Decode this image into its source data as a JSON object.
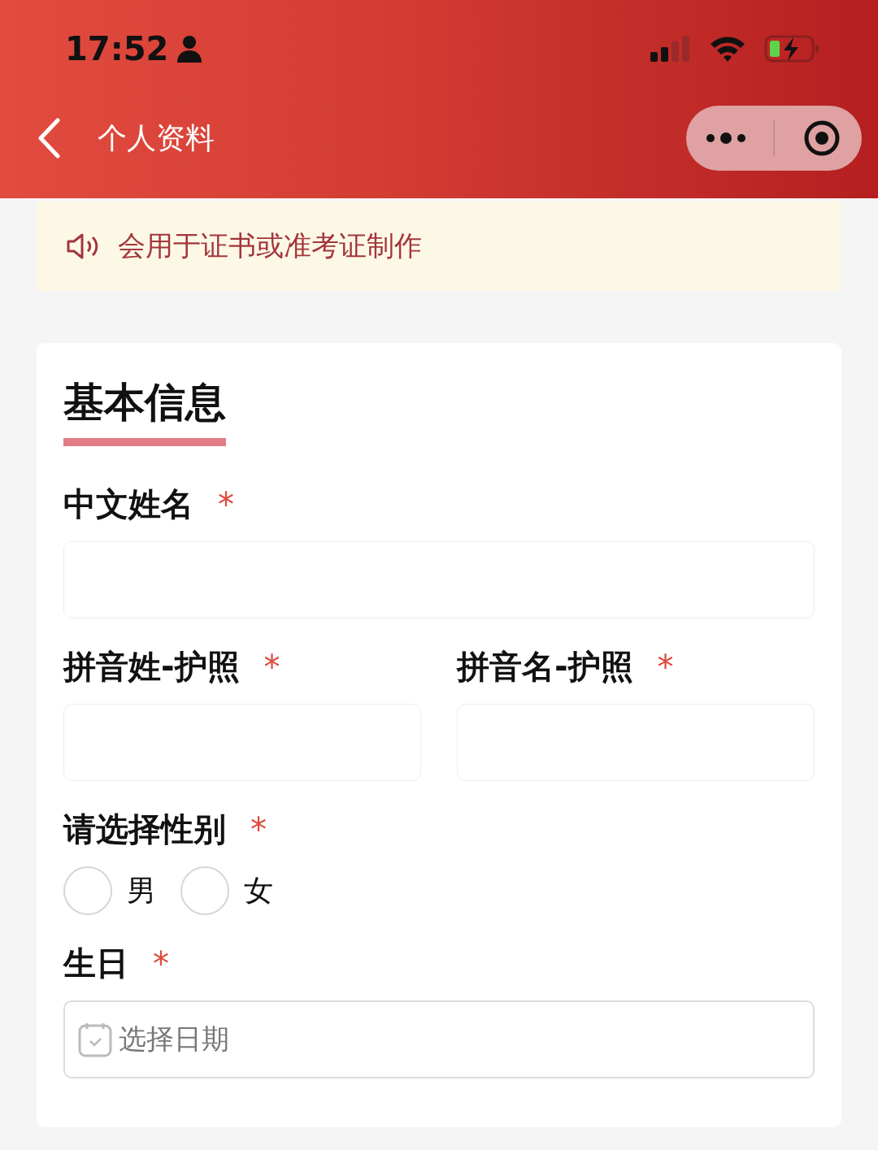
{
  "status_bar": {
    "time": "17:52"
  },
  "nav": {
    "title": "个人资料"
  },
  "notice": {
    "text": "会用于证书或准考证制作"
  },
  "section": {
    "title": "基本信息",
    "rows": [
      {
        "fields": [
          {
            "kind": "text",
            "label": "中文姓名",
            "mark": "*"
          }
        ]
      },
      {
        "fields": [
          {
            "kind": "text",
            "label": "拼音姓-护照",
            "mark": "*"
          },
          {
            "kind": "text",
            "label": "拼音名-护照",
            "mark": "*"
          }
        ]
      },
      {
        "fields": [
          {
            "kind": "radio",
            "label": "请选择性别",
            "mark": "*",
            "options": [
              {
                "label": "男",
                "selected": false
              },
              {
                "label": "女",
                "selected": false
              }
            ]
          }
        ]
      },
      {
        "fields": [
          {
            "kind": "date",
            "label": "生日",
            "mark": "*",
            "placeholder": "选择日期"
          }
        ]
      }
    ]
  }
}
